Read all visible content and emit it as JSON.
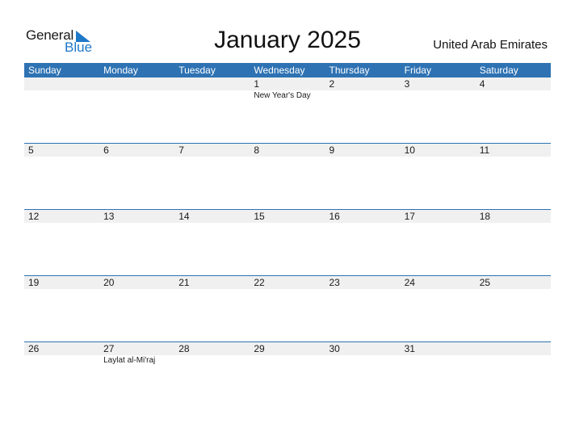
{
  "logo": {
    "general": "General",
    "blue": "Blue"
  },
  "title": "January 2025",
  "country": "United Arab Emirates",
  "colors": {
    "accent": "#2e72b3",
    "row_strip": "#f0f0f0",
    "logo_blue": "#1f78c8"
  },
  "weekdays": [
    "Sunday",
    "Monday",
    "Tuesday",
    "Wednesday",
    "Thursday",
    "Friday",
    "Saturday"
  ],
  "weeks": [
    {
      "days": [
        "",
        "",
        "",
        "1",
        "2",
        "3",
        "4"
      ],
      "events": [
        "",
        "",
        "",
        "New Year's Day",
        "",
        "",
        ""
      ]
    },
    {
      "days": [
        "5",
        "6",
        "7",
        "8",
        "9",
        "10",
        "11"
      ],
      "events": [
        "",
        "",
        "",
        "",
        "",
        "",
        ""
      ]
    },
    {
      "days": [
        "12",
        "13",
        "14",
        "15",
        "16",
        "17",
        "18"
      ],
      "events": [
        "",
        "",
        "",
        "",
        "",
        "",
        ""
      ]
    },
    {
      "days": [
        "19",
        "20",
        "21",
        "22",
        "23",
        "24",
        "25"
      ],
      "events": [
        "",
        "",
        "",
        "",
        "",
        "",
        ""
      ]
    },
    {
      "days": [
        "26",
        "27",
        "28",
        "29",
        "30",
        "31",
        ""
      ],
      "events": [
        "",
        "Laylat al-Mi'raj",
        "",
        "",
        "",
        "",
        ""
      ]
    }
  ]
}
